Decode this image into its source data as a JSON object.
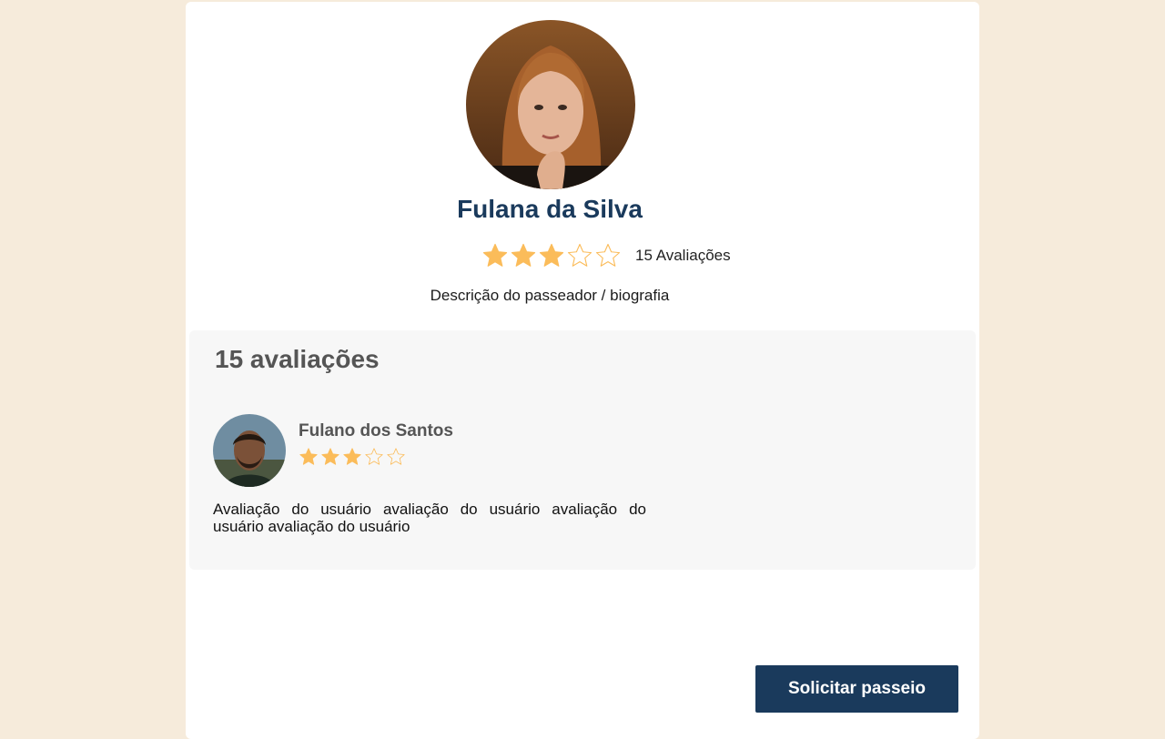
{
  "profile": {
    "name": "Fulana da Silva",
    "rating": 3,
    "max_rating": 5,
    "rating_count_label": "15 Avaliações",
    "bio": "Descrição do passeador / biografia"
  },
  "reviews": {
    "title": "15 avaliações",
    "items": [
      {
        "reviewer_name": "Fulano dos Santos",
        "rating": 3,
        "max_rating": 5,
        "text": "Avaliação do usuário avaliação do usuário avaliação do usuário avaliação do usuário"
      }
    ]
  },
  "actions": {
    "request_walk_label": "Solicitar passeio"
  },
  "colors": {
    "page_background": "#f6ebdb",
    "accent_navy": "#1a3a5c",
    "star_filled": "#fbbc5a",
    "reviews_panel": "#f7f7f7"
  }
}
